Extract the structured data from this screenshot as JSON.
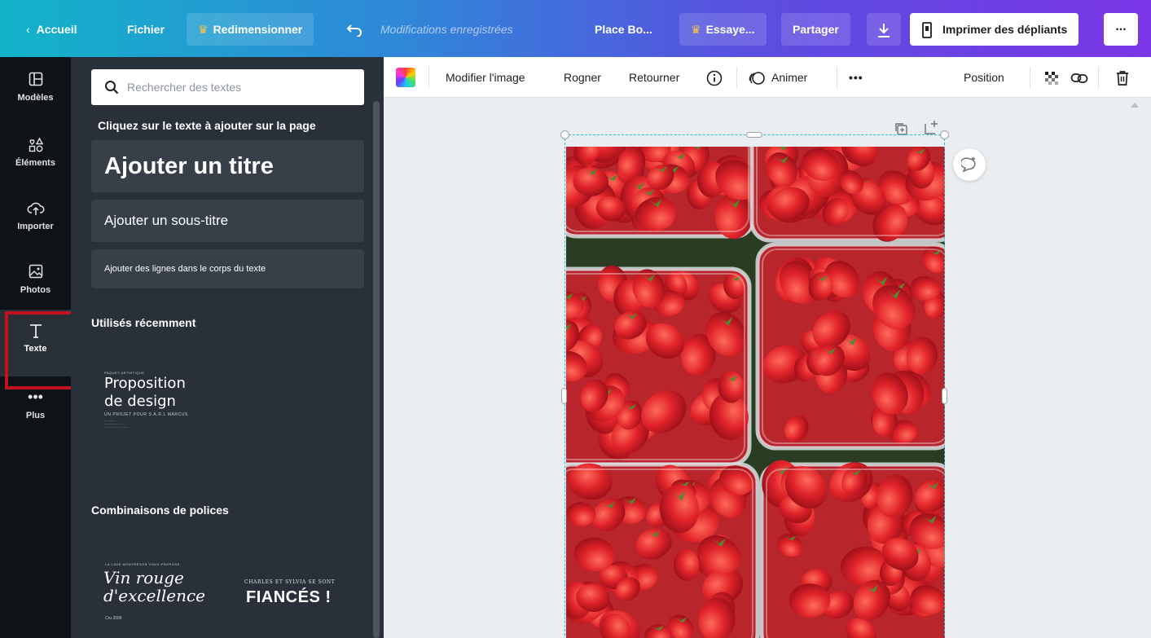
{
  "topbar": {
    "home": "Accueil",
    "file": "Fichier",
    "resize": "Redimensionner",
    "saved_status": "Modifications enregistrées",
    "doc_title": "Place Bo...",
    "try": "Essaye...",
    "share": "Partager",
    "print": "Imprimer des dépliants",
    "more": "..."
  },
  "rail": {
    "items": [
      {
        "label": "Modèles",
        "icon": "templates-icon"
      },
      {
        "label": "Éléments",
        "icon": "elements-icon"
      },
      {
        "label": "Importer",
        "icon": "upload-icon"
      },
      {
        "label": "Photos",
        "icon": "photos-icon"
      },
      {
        "label": "Texte",
        "icon": "text-icon",
        "active": true
      },
      {
        "label": "Plus",
        "icon": "more-icon"
      }
    ]
  },
  "panel": {
    "search_placeholder": "Rechercher des textes",
    "instruction": "Cliquez sur le texte à ajouter sur la page",
    "add_title": "Ajouter un titre",
    "add_subtitle": "Ajouter un sous-titre",
    "add_body": "Ajouter des lignes dans le corps du texte",
    "recent_heading": "Utilisés récemment",
    "recent_thumb": {
      "eyebrow": "PAQUET ARTISTIQUE",
      "line1": "Proposition",
      "line2": "de design",
      "sub": "UN PROJET POUR S.A.R.L MARCUS"
    },
    "combos_heading": "Combinaisons de polices",
    "combo_thumb": {
      "eyebrow": "LA CAVE MONTRÉSOR VOUS PROPOSE",
      "script1": "Vin rouge",
      "script2": "d'excellence",
      "date": "Cru 2006",
      "eyebrow2": "CHARLES ET SYLVIA SE SONT",
      "bold": "FIANCÉS !"
    }
  },
  "context_toolbar": {
    "edit_image": "Modifier l'image",
    "crop": "Rogner",
    "flip": "Retourner",
    "animate": "Animer",
    "more": "•••",
    "position": "Position"
  },
  "colors": {
    "topbar_start": "#12b4c9",
    "topbar_end": "#7a36e6",
    "rail_bg": "#0e1318",
    "panel_bg": "#293039",
    "card_bg": "#373f49",
    "active_outline": "#c2111f",
    "selection": "#21c3d4",
    "crown": "#ffc640"
  }
}
